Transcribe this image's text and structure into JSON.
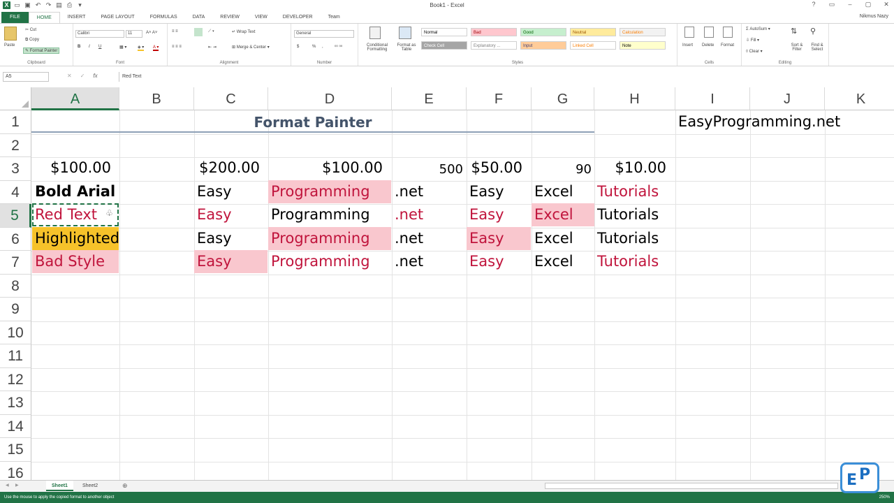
{
  "title_bar": {
    "document_title": "Book1 - Excel",
    "qat_icons": [
      "excel-logo",
      "new-icon",
      "save-icon",
      "undo-icon",
      "redo-icon",
      "print-preview-icon",
      "quick-print-icon",
      "customize-icon"
    ]
  },
  "tabs": [
    "FILE",
    "HOME",
    "INSERT",
    "PAGE LAYOUT",
    "FORMULAS",
    "DATA",
    "REVIEW",
    "VIEW",
    "DEVELOPER",
    "Team"
  ],
  "active_tab": "HOME",
  "user_name": "Nikmus Nazy",
  "ribbon": {
    "clipboard": {
      "paste": "Paste",
      "cut": "Cut",
      "copy": "Copy",
      "format_painter": "Format Painter",
      "label": "Clipboard"
    },
    "font": {
      "font_name": "Calibri",
      "font_size": "11",
      "label": "Font",
      "bold": "B",
      "italic": "I",
      "underline": "U"
    },
    "alignment": {
      "wrap_text": "Wrap Text",
      "merge_center": "Merge & Center",
      "label": "Alignment"
    },
    "number": {
      "format": "General",
      "currency": "$",
      "percent": "%",
      "label": "Number"
    },
    "styles": {
      "conditional_formatting": "Conditional Formatting",
      "format_as_table": "Format as Table",
      "cells": [
        {
          "label": "Normal",
          "bg": "#ffffff",
          "fg": "#000000"
        },
        {
          "label": "Bad",
          "bg": "#ffc7ce",
          "fg": "#9c0006"
        },
        {
          "label": "Good",
          "bg": "#c6efce",
          "fg": "#006100"
        },
        {
          "label": "Neutral",
          "bg": "#ffeb9c",
          "fg": "#9c5700"
        },
        {
          "label": "Calculation",
          "bg": "#f2f2f2",
          "fg": "#fa7d00"
        },
        {
          "label": "Check Cell",
          "bg": "#a5a5a5",
          "fg": "#ffffff"
        },
        {
          "label": "Explanatory ...",
          "bg": "#ffffff",
          "fg": "#7f7f7f"
        },
        {
          "label": "Input",
          "bg": "#ffcc99",
          "fg": "#3f3f76"
        },
        {
          "label": "Linked Cell",
          "bg": "#ffffff",
          "fg": "#fa7d00"
        },
        {
          "label": "Note",
          "bg": "#ffffcc",
          "fg": "#000000"
        }
      ],
      "label": "Styles"
    },
    "cells_group": {
      "insert": "Insert",
      "delete": "Delete",
      "format": "Format",
      "label": "Cells"
    },
    "editing": {
      "autosum": "AutoSum",
      "fill": "Fill",
      "clear": "Clear",
      "sort_filter": "Sort & Filter",
      "find_select": "Find & Select",
      "label": "Editing"
    }
  },
  "formula_bar": {
    "name_box": "A5",
    "fx": "fx",
    "formula": "Red Text"
  },
  "columns": [
    "A",
    "B",
    "C",
    "D",
    "E",
    "F",
    "G",
    "H",
    "I",
    "J",
    "K"
  ],
  "selected_column": "A",
  "rows": [
    "1",
    "2",
    "3",
    "4",
    "5",
    "6",
    "7",
    "8",
    "9",
    "10",
    "11",
    "12",
    "13",
    "14",
    "15",
    "16"
  ],
  "selected_row": "5",
  "cells": {
    "C1_merged": "Format Painter",
    "I1": "EasyProgramming.net",
    "A3": "$100.00",
    "C3": "$200.00",
    "D3": "$100.00",
    "E3": "500",
    "F3": "$50.00",
    "G3": "90",
    "H3": "$10.00",
    "A4": "Bold Arial",
    "C4": "Easy",
    "D4": "Programming",
    "E4": ".net",
    "F4": "Easy",
    "G4": "Excel",
    "H4": "Tutorials",
    "A5": "Red Text",
    "C5": "Easy",
    "D5": "Programming",
    "E5": ".net",
    "F5": "Easy",
    "G5": "Excel",
    "H5": "Tutorials",
    "A6": "Highlighted",
    "C6": "Easy",
    "D6": "Programming",
    "E6": ".net",
    "F6": "Easy",
    "G6": "Excel",
    "H6": "Tutorials",
    "A7": "Bad Style",
    "C7": "Easy",
    "D7": "Programming",
    "E7": ".net",
    "F7": "Easy",
    "G7": "Excel",
    "H7": "Tutorials"
  },
  "sheets": [
    "Sheet1",
    "Sheet2"
  ],
  "active_sheet": "Sheet1",
  "status": {
    "message": "Use the mouse to apply the copied format to another object",
    "zoom": "250%"
  },
  "logo": {
    "letter1": "E",
    "letter2": "P"
  }
}
